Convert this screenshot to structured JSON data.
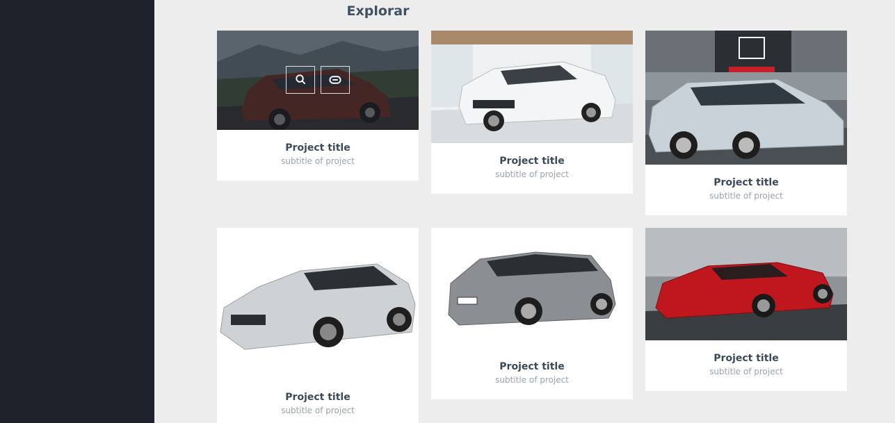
{
  "page": {
    "title": "Explorar"
  },
  "projects": [
    {
      "title": "Project title",
      "subtitle": "subtitle of project",
      "image": "peugeot-suv-photo"
    },
    {
      "title": "Project title",
      "subtitle": "subtitle of project",
      "image": "toyota-corolla-photo"
    },
    {
      "title": "Project title",
      "subtitle": "subtitle of project",
      "image": "honda-civic-photo"
    },
    {
      "title": "Project title",
      "subtitle": "subtitle of project",
      "image": "subaru-wrx-photo"
    },
    {
      "title": "Project title",
      "subtitle": "subtitle of project",
      "image": "suzuki-baleno-photo"
    },
    {
      "title": "Project title",
      "subtitle": "subtitle of project",
      "image": "ferrari-812-photo"
    }
  ],
  "hover_actions": {
    "icons": [
      "search-icon",
      "link-icon"
    ]
  },
  "colors": {
    "sidebar": "#1e232b",
    "background": "#ededed",
    "title": "#3f5162",
    "subtitle": "#9aa4ae"
  }
}
